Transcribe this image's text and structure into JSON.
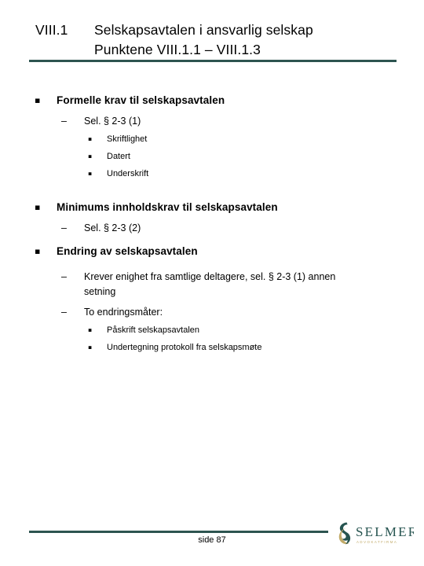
{
  "slide": {
    "title": {
      "number": "VIII.1",
      "line1": "Selskapsavtalen i ansvarlig selskap",
      "line2": "Punktene VIII.1.1 – VIII.1.3"
    },
    "accent_color": "#2d5450",
    "text_color": "#000000",
    "background_color": "#ffffff",
    "markers": {
      "level1": "§",
      "level1_glyph": "▪",
      "level2": "–",
      "level3": "▪"
    },
    "content": [
      {
        "level": 1,
        "text": "Formelle krav til selskapsavtalen"
      },
      {
        "level": 2,
        "text": "Sel. § 2-3 (1)"
      },
      {
        "level": 3,
        "text": "Skriftlighet"
      },
      {
        "level": 3,
        "text": "Datert"
      },
      {
        "level": 3,
        "text": "Underskrift"
      },
      {
        "level": 1,
        "text": "Minimums innholdskrav til selskapsavtalen"
      },
      {
        "level": 2,
        "text": "Sel. § 2-3 (2)"
      },
      {
        "level": 1,
        "text": "Endring av selskapsavtalen"
      },
      {
        "level": 2,
        "text": "Krever enighet fra samtlige deltagere, sel. § 2-3 (1) annen setning"
      },
      {
        "level": 2,
        "text": "To endringsmåter:"
      },
      {
        "level": 3,
        "text": "Påskrift selskapsavtalen"
      },
      {
        "level": 3,
        "text": "Undertegning protokoll fra selskapsmøte"
      }
    ],
    "footer": {
      "page_label": "side 87",
      "logo": {
        "wordmark": "SELMER",
        "tagline": "ADVOKATFIRMA",
        "mark_color_dark": "#265450",
        "mark_color_gold": "#c2ab6a"
      }
    }
  }
}
